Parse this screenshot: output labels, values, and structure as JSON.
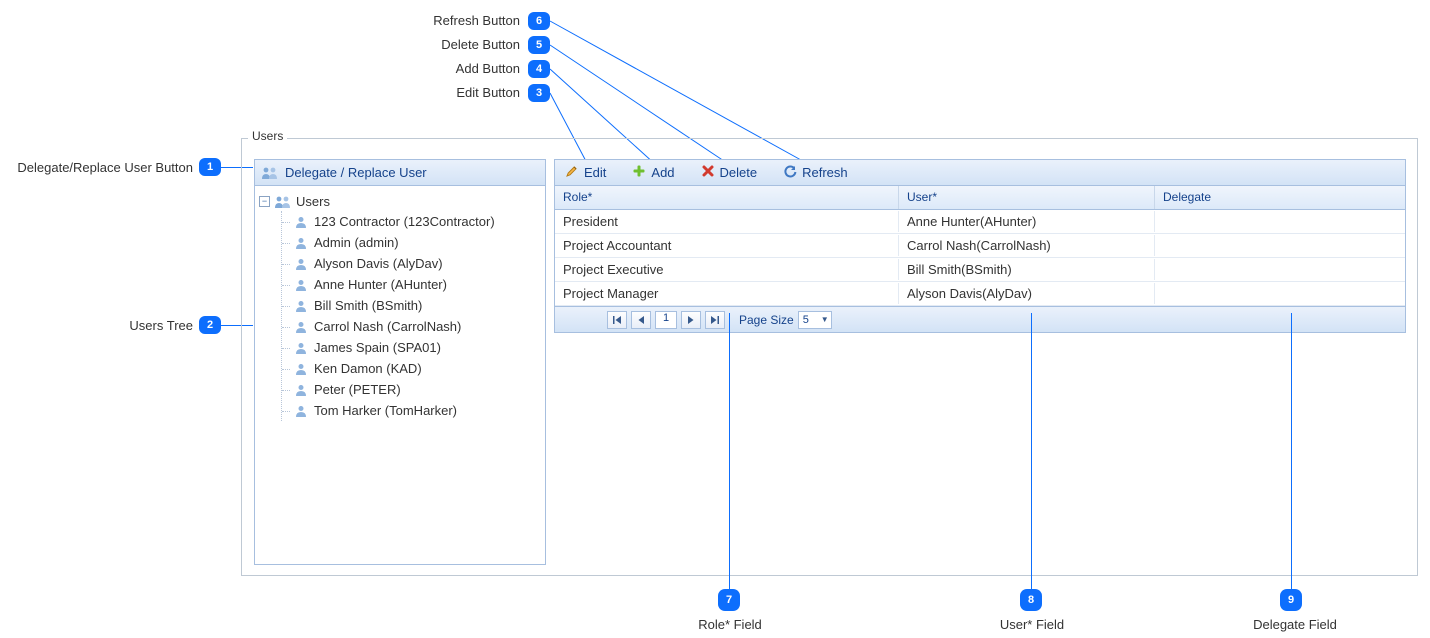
{
  "callouts": {
    "top": [
      {
        "n": "6",
        "label": "Refresh Button"
      },
      {
        "n": "5",
        "label": "Delete Button"
      },
      {
        "n": "4",
        "label": "Add Button"
      },
      {
        "n": "3",
        "label": "Edit Button"
      }
    ],
    "left": [
      {
        "n": "1",
        "label": "Delegate/Replace User Button"
      },
      {
        "n": "2",
        "label": "Users Tree"
      }
    ],
    "bottom": [
      {
        "n": "7",
        "label": "Role* Field"
      },
      {
        "n": "8",
        "label": "User* Field"
      },
      {
        "n": "9",
        "label": "Delegate Field"
      }
    ]
  },
  "fieldset_title": "Users",
  "tree": {
    "toolbar_label": "Delegate / Replace User",
    "root_label": "Users",
    "items": [
      "123 Contractor (123Contractor)",
      "Admin (admin)",
      "Alyson Davis (AlyDav)",
      "Anne Hunter (AHunter)",
      "Bill Smith (BSmith)",
      "Carrol Nash (CarrolNash)",
      "James Spain (SPA01)",
      "Ken Damon (KAD)",
      "Peter (PETER)",
      "Tom Harker (TomHarker)"
    ]
  },
  "toolbar": {
    "edit": "Edit",
    "add": "Add",
    "delete": "Delete",
    "refresh": "Refresh"
  },
  "grid": {
    "headers": {
      "role": "Role*",
      "user": "User*",
      "delegate": "Delegate"
    },
    "rows": [
      {
        "role": "President",
        "user": "Anne Hunter(AHunter)",
        "delegate": ""
      },
      {
        "role": "Project Accountant",
        "user": "Carrol Nash(CarrolNash)",
        "delegate": ""
      },
      {
        "role": "Project Executive",
        "user": "Bill Smith(BSmith)",
        "delegate": ""
      },
      {
        "role": "Project Manager",
        "user": "Alyson Davis(AlyDav)",
        "delegate": ""
      }
    ]
  },
  "pager": {
    "page": "1",
    "page_size_label": "Page Size",
    "page_size": "5"
  }
}
